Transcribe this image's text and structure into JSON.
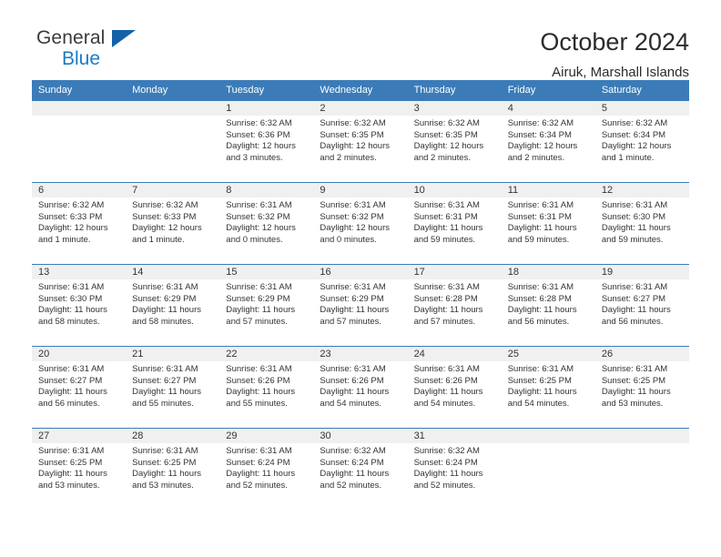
{
  "logo": {
    "primary_text": "General",
    "secondary_text": "Blue",
    "primary_color": "#3b3b3b",
    "secondary_color": "#1a7bc4",
    "triangle_color": "#1361a8",
    "icon_name": "general-blue-logo"
  },
  "header": {
    "title": "October 2024",
    "subtitle": "Airuk, Marshall Islands"
  },
  "calendar": {
    "header_bg_color": "#3b7cb8",
    "grid_line_color": "#3b7cb8",
    "daynum_band_color": "#f0f0f0",
    "weekday_headers": [
      "Sunday",
      "Monday",
      "Tuesday",
      "Wednesday",
      "Thursday",
      "Friday",
      "Saturday"
    ],
    "weeks": [
      [
        {
          "day": "",
          "sunrise": "",
          "sunset": "",
          "daylight_line1": "",
          "daylight_line2": ""
        },
        {
          "day": "",
          "sunrise": "",
          "sunset": "",
          "daylight_line1": "",
          "daylight_line2": ""
        },
        {
          "day": "1",
          "sunrise": "Sunrise: 6:32 AM",
          "sunset": "Sunset: 6:36 PM",
          "daylight_line1": "Daylight: 12 hours",
          "daylight_line2": "and 3 minutes."
        },
        {
          "day": "2",
          "sunrise": "Sunrise: 6:32 AM",
          "sunset": "Sunset: 6:35 PM",
          "daylight_line1": "Daylight: 12 hours",
          "daylight_line2": "and 2 minutes."
        },
        {
          "day": "3",
          "sunrise": "Sunrise: 6:32 AM",
          "sunset": "Sunset: 6:35 PM",
          "daylight_line1": "Daylight: 12 hours",
          "daylight_line2": "and 2 minutes."
        },
        {
          "day": "4",
          "sunrise": "Sunrise: 6:32 AM",
          "sunset": "Sunset: 6:34 PM",
          "daylight_line1": "Daylight: 12 hours",
          "daylight_line2": "and 2 minutes."
        },
        {
          "day": "5",
          "sunrise": "Sunrise: 6:32 AM",
          "sunset": "Sunset: 6:34 PM",
          "daylight_line1": "Daylight: 12 hours",
          "daylight_line2": "and 1 minute."
        }
      ],
      [
        {
          "day": "6",
          "sunrise": "Sunrise: 6:32 AM",
          "sunset": "Sunset: 6:33 PM",
          "daylight_line1": "Daylight: 12 hours",
          "daylight_line2": "and 1 minute."
        },
        {
          "day": "7",
          "sunrise": "Sunrise: 6:32 AM",
          "sunset": "Sunset: 6:33 PM",
          "daylight_line1": "Daylight: 12 hours",
          "daylight_line2": "and 1 minute."
        },
        {
          "day": "8",
          "sunrise": "Sunrise: 6:31 AM",
          "sunset": "Sunset: 6:32 PM",
          "daylight_line1": "Daylight: 12 hours",
          "daylight_line2": "and 0 minutes."
        },
        {
          "day": "9",
          "sunrise": "Sunrise: 6:31 AM",
          "sunset": "Sunset: 6:32 PM",
          "daylight_line1": "Daylight: 12 hours",
          "daylight_line2": "and 0 minutes."
        },
        {
          "day": "10",
          "sunrise": "Sunrise: 6:31 AM",
          "sunset": "Sunset: 6:31 PM",
          "daylight_line1": "Daylight: 11 hours",
          "daylight_line2": "and 59 minutes."
        },
        {
          "day": "11",
          "sunrise": "Sunrise: 6:31 AM",
          "sunset": "Sunset: 6:31 PM",
          "daylight_line1": "Daylight: 11 hours",
          "daylight_line2": "and 59 minutes."
        },
        {
          "day": "12",
          "sunrise": "Sunrise: 6:31 AM",
          "sunset": "Sunset: 6:30 PM",
          "daylight_line1": "Daylight: 11 hours",
          "daylight_line2": "and 59 minutes."
        }
      ],
      [
        {
          "day": "13",
          "sunrise": "Sunrise: 6:31 AM",
          "sunset": "Sunset: 6:30 PM",
          "daylight_line1": "Daylight: 11 hours",
          "daylight_line2": "and 58 minutes."
        },
        {
          "day": "14",
          "sunrise": "Sunrise: 6:31 AM",
          "sunset": "Sunset: 6:29 PM",
          "daylight_line1": "Daylight: 11 hours",
          "daylight_line2": "and 58 minutes."
        },
        {
          "day": "15",
          "sunrise": "Sunrise: 6:31 AM",
          "sunset": "Sunset: 6:29 PM",
          "daylight_line1": "Daylight: 11 hours",
          "daylight_line2": "and 57 minutes."
        },
        {
          "day": "16",
          "sunrise": "Sunrise: 6:31 AM",
          "sunset": "Sunset: 6:29 PM",
          "daylight_line1": "Daylight: 11 hours",
          "daylight_line2": "and 57 minutes."
        },
        {
          "day": "17",
          "sunrise": "Sunrise: 6:31 AM",
          "sunset": "Sunset: 6:28 PM",
          "daylight_line1": "Daylight: 11 hours",
          "daylight_line2": "and 57 minutes."
        },
        {
          "day": "18",
          "sunrise": "Sunrise: 6:31 AM",
          "sunset": "Sunset: 6:28 PM",
          "daylight_line1": "Daylight: 11 hours",
          "daylight_line2": "and 56 minutes."
        },
        {
          "day": "19",
          "sunrise": "Sunrise: 6:31 AM",
          "sunset": "Sunset: 6:27 PM",
          "daylight_line1": "Daylight: 11 hours",
          "daylight_line2": "and 56 minutes."
        }
      ],
      [
        {
          "day": "20",
          "sunrise": "Sunrise: 6:31 AM",
          "sunset": "Sunset: 6:27 PM",
          "daylight_line1": "Daylight: 11 hours",
          "daylight_line2": "and 56 minutes."
        },
        {
          "day": "21",
          "sunrise": "Sunrise: 6:31 AM",
          "sunset": "Sunset: 6:27 PM",
          "daylight_line1": "Daylight: 11 hours",
          "daylight_line2": "and 55 minutes."
        },
        {
          "day": "22",
          "sunrise": "Sunrise: 6:31 AM",
          "sunset": "Sunset: 6:26 PM",
          "daylight_line1": "Daylight: 11 hours",
          "daylight_line2": "and 55 minutes."
        },
        {
          "day": "23",
          "sunrise": "Sunrise: 6:31 AM",
          "sunset": "Sunset: 6:26 PM",
          "daylight_line1": "Daylight: 11 hours",
          "daylight_line2": "and 54 minutes."
        },
        {
          "day": "24",
          "sunrise": "Sunrise: 6:31 AM",
          "sunset": "Sunset: 6:26 PM",
          "daylight_line1": "Daylight: 11 hours",
          "daylight_line2": "and 54 minutes."
        },
        {
          "day": "25",
          "sunrise": "Sunrise: 6:31 AM",
          "sunset": "Sunset: 6:25 PM",
          "daylight_line1": "Daylight: 11 hours",
          "daylight_line2": "and 54 minutes."
        },
        {
          "day": "26",
          "sunrise": "Sunrise: 6:31 AM",
          "sunset": "Sunset: 6:25 PM",
          "daylight_line1": "Daylight: 11 hours",
          "daylight_line2": "and 53 minutes."
        }
      ],
      [
        {
          "day": "27",
          "sunrise": "Sunrise: 6:31 AM",
          "sunset": "Sunset: 6:25 PM",
          "daylight_line1": "Daylight: 11 hours",
          "daylight_line2": "and 53 minutes."
        },
        {
          "day": "28",
          "sunrise": "Sunrise: 6:31 AM",
          "sunset": "Sunset: 6:25 PM",
          "daylight_line1": "Daylight: 11 hours",
          "daylight_line2": "and 53 minutes."
        },
        {
          "day": "29",
          "sunrise": "Sunrise: 6:31 AM",
          "sunset": "Sunset: 6:24 PM",
          "daylight_line1": "Daylight: 11 hours",
          "daylight_line2": "and 52 minutes."
        },
        {
          "day": "30",
          "sunrise": "Sunrise: 6:32 AM",
          "sunset": "Sunset: 6:24 PM",
          "daylight_line1": "Daylight: 11 hours",
          "daylight_line2": "and 52 minutes."
        },
        {
          "day": "31",
          "sunrise": "Sunrise: 6:32 AM",
          "sunset": "Sunset: 6:24 PM",
          "daylight_line1": "Daylight: 11 hours",
          "daylight_line2": "and 52 minutes."
        },
        {
          "day": "",
          "sunrise": "",
          "sunset": "",
          "daylight_line1": "",
          "daylight_line2": ""
        },
        {
          "day": "",
          "sunrise": "",
          "sunset": "",
          "daylight_line1": "",
          "daylight_line2": ""
        }
      ]
    ]
  }
}
